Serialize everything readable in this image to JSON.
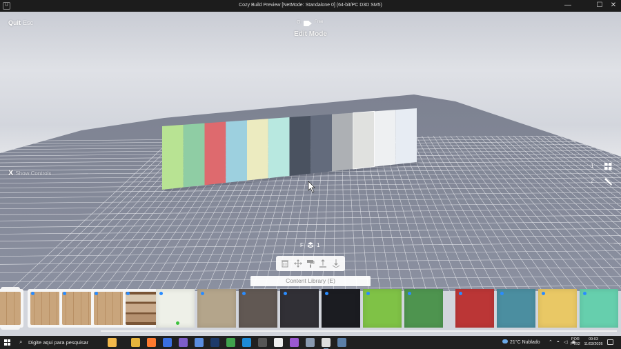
{
  "window": {
    "title": "Cozy Build Preview [NetMode: Standalone 0]  (64-bit/PC D3D SM5)",
    "app_icon": "U",
    "minimize": "—",
    "maximize": "☐",
    "close": "✕"
  },
  "hud": {
    "quit_label": "Quit",
    "quit_key": "Esc",
    "mode_key": "G",
    "camera_mode": "Free",
    "edit_mode": "Edit Mode",
    "show_controls_key": "X",
    "show_controls_label": "Show Controls",
    "side_options": [
      {
        "num": "1",
        "icon": "grid-icon"
      },
      {
        "num": "2",
        "icon": "brush-icon"
      }
    ],
    "floor_key": "F",
    "floor_number": "1",
    "tools": [
      "delete-icon",
      "move-icon",
      "paint-icon",
      "raise-icon",
      "lower-icon"
    ],
    "content_library": "Content Library (E)"
  },
  "wall_colors": [
    "#b8e393",
    "#8fcda4",
    "#de6a6e",
    "#9dd0df",
    "#ecebc0",
    "#b8e8e0",
    "#4a5260",
    "#636b7c",
    "#adb0b4",
    "#e0e1df",
    "#eef0f2",
    "#e7ecf3"
  ],
  "library": {
    "categories": [
      "cube-icon",
      "decor-icon",
      "paint-roller-icon"
    ],
    "items": [
      {
        "type": "wood",
        "color": "#c9a57c",
        "marker": false,
        "framed": true,
        "partial": true
      },
      {
        "type": "wood",
        "color": "#c9a57c",
        "marker": true,
        "framed": true
      },
      {
        "type": "wood",
        "color": "#c9a57c",
        "marker": true,
        "framed": true
      },
      {
        "type": "wood",
        "color": "#c9a57c",
        "marker": true,
        "framed": true
      },
      {
        "type": "bookshelf",
        "color": "#7a5536",
        "marker": true,
        "framed": true
      },
      {
        "type": "swatch",
        "color": "#eef0e8",
        "marker": true,
        "selected": true
      },
      {
        "type": "swatch",
        "color": "#b4a58b",
        "marker": true
      },
      {
        "type": "swatch",
        "color": "#615853",
        "marker": true
      },
      {
        "type": "swatch",
        "color": "#313036",
        "marker": true
      },
      {
        "type": "swatch",
        "color": "#1b1c21",
        "marker": true
      },
      {
        "type": "swatch",
        "color": "#7fc246",
        "marker": true
      },
      {
        "type": "swatch",
        "color": "#4e944f",
        "marker": true
      },
      {
        "type": "swatch",
        "color": "#bb3636",
        "marker": true
      },
      {
        "type": "swatch",
        "color": "#4b8ea0",
        "marker": true
      },
      {
        "type": "swatch",
        "color": "#e9c865",
        "marker": true
      },
      {
        "type": "swatch",
        "color": "#66cfad",
        "marker": true
      }
    ]
  },
  "taskbar": {
    "search_placeholder": "Digite aqui para pesquisar",
    "apps": [
      {
        "name": "copilot-icon",
        "color": "#f2b84b"
      },
      {
        "name": "file-explorer-icon",
        "color": "#e7b43c"
      },
      {
        "name": "firefox-icon",
        "color": "#ff7a2f"
      },
      {
        "name": "firefox-dev-icon",
        "color": "#3a6fe0"
      },
      {
        "name": "visual-studio-icon",
        "color": "#7d5ec9"
      },
      {
        "name": "browser-icon",
        "color": "#5a8de0"
      },
      {
        "name": "photoshop-icon",
        "color": "#1e3a6a"
      },
      {
        "name": "chrome-icon",
        "color": "#3fa34d"
      },
      {
        "name": "edge-icon",
        "color": "#1d8ad6"
      },
      {
        "name": "terminal-icon",
        "color": "#555555"
      },
      {
        "name": "app-w-icon",
        "color": "#eeeeee"
      },
      {
        "name": "github-icon",
        "color": "#9b59d0"
      },
      {
        "name": "app-stack-icon",
        "color": "#8a9ab0"
      },
      {
        "name": "unreal-icon",
        "color": "#dddddd"
      },
      {
        "name": "calculator-icon",
        "color": "#5b7fa8"
      }
    ],
    "weather_temp": "21°C",
    "weather_desc": "Nublado",
    "lang_top": "POR",
    "lang_bottom": "PTB2",
    "time": "09:03",
    "date": "11/03/2026"
  }
}
